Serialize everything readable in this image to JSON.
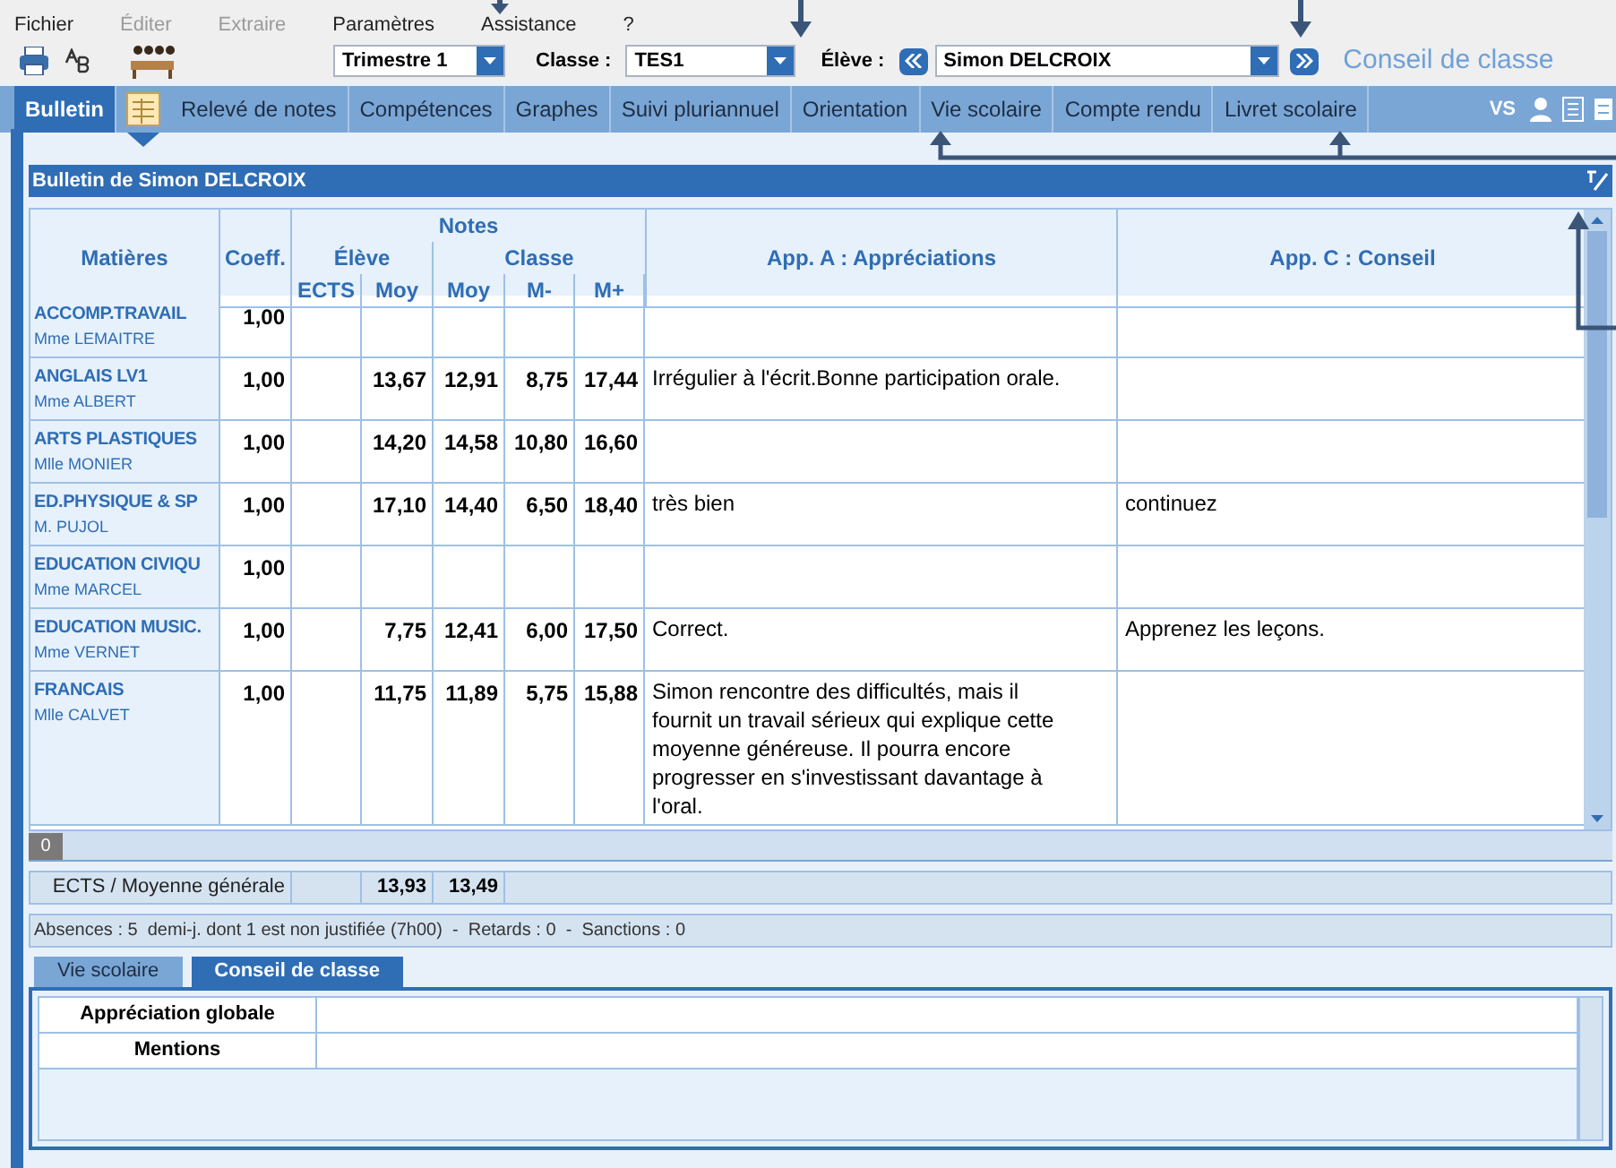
{
  "menu": [
    {
      "label": "Fichier",
      "disabled": false
    },
    {
      "label": "Éditer",
      "disabled": true
    },
    {
      "label": "Extraire",
      "disabled": true
    },
    {
      "label": "Paramètres",
      "disabled": false
    },
    {
      "label": "Assistance",
      "disabled": false
    },
    {
      "label": "?",
      "disabled": false
    }
  ],
  "toolbar": {
    "period": {
      "value": "Trimestre 1"
    },
    "class_label": "Classe :",
    "class": {
      "value": "TES1"
    },
    "student_label": "Élève :",
    "student": {
      "value": "Simon DELCROIX"
    },
    "view_title": "Conseil de classe"
  },
  "tabs": [
    {
      "label": "Bulletin",
      "selected": true
    },
    {
      "label": "Relevé de notes",
      "selected": false
    },
    {
      "label": "Compétences",
      "selected": false
    },
    {
      "label": "Graphes",
      "selected": false
    },
    {
      "label": "Suivi pluriannuel",
      "selected": false
    },
    {
      "label": "Orientation",
      "selected": false
    },
    {
      "label": "Vie scolaire",
      "selected": false
    },
    {
      "label": "Compte rendu",
      "selected": false
    },
    {
      "label": "Livret scolaire",
      "selected": false
    }
  ],
  "tab_bar_text": "VS",
  "panel_title": "Bulletin de Simon DELCROIX",
  "table": {
    "headers": {
      "subject": "Matières",
      "coeff": "Coeff.",
      "notes": "Notes",
      "student": "Élève",
      "class": "Classe",
      "ects": "ECTS",
      "moy": "Moy",
      "class_moy": "Moy",
      "class_min": "M-",
      "class_max": "M+",
      "app_a": "App. A : Appréciations",
      "app_c": "App. C : Conseil"
    },
    "rows": [
      {
        "subject": "ACCOMP.TRAVAIL",
        "teacher": "Mme LEMAITRE",
        "coeff": "1,00",
        "moy": "",
        "class_moy": "",
        "class_min": "",
        "class_max": "",
        "app_a": "",
        "app_c": ""
      },
      {
        "subject": "ANGLAIS LV1",
        "teacher": "Mme ALBERT",
        "coeff": "1,00",
        "moy": "13,67",
        "class_moy": "12,91",
        "class_min": "8,75",
        "class_max": "17,44",
        "app_a": "Irrégulier à l'écrit.Bonne participation orale.",
        "app_c": ""
      },
      {
        "subject": "ARTS PLASTIQUES",
        "teacher": "Mlle MONIER",
        "coeff": "1,00",
        "moy": "14,20",
        "class_moy": "14,58",
        "class_min": "10,80",
        "class_max": "16,60",
        "app_a": "",
        "app_c": ""
      },
      {
        "subject": "ED.PHYSIQUE & SP",
        "teacher": "M. PUJOL",
        "coeff": "1,00",
        "moy": "17,10",
        "class_moy": "14,40",
        "class_min": "6,50",
        "class_max": "18,40",
        "app_a": "très bien",
        "app_c": "continuez"
      },
      {
        "subject": "EDUCATION CIVIQU",
        "teacher": "Mme MARCEL",
        "coeff": "1,00",
        "moy": "",
        "class_moy": "",
        "class_min": "",
        "class_max": "",
        "app_a": "",
        "app_c": ""
      },
      {
        "subject": "EDUCATION MUSIC.",
        "teacher": "Mme VERNET",
        "coeff": "1,00",
        "moy": "7,75",
        "class_moy": "12,41",
        "class_min": "6,00",
        "class_max": "17,50",
        "app_a": "Correct.",
        "app_c": "Apprenez les leçons."
      },
      {
        "subject": "FRANCAIS",
        "teacher": "Mlle CALVET",
        "coeff": "1,00",
        "moy": "11,75",
        "class_moy": "11,89",
        "class_min": "5,75",
        "class_max": "15,88",
        "app_a": "Simon rencontre des difficultés, mais il fournit un travail sérieux qui explique cette moyenne généreuse. Il pourra encore progresser en s'investissant davantage à l'oral.",
        "app_c": ""
      }
    ]
  },
  "scroll_badge": "0",
  "summary": {
    "label": "ECTS / Moyenne générale",
    "student_avg": "13,93",
    "class_avg": "13,49"
  },
  "absences": "Absences : 5  demi-j. dont 1 est non justifiée (7h00)  -  Retards : 0  -  Sanctions : 0",
  "bottom_tabs": [
    {
      "label": "Vie scolaire",
      "selected": false
    },
    {
      "label": "Conseil de classe",
      "selected": true
    }
  ],
  "conseil_rows": [
    {
      "label": "Appréciation globale",
      "value": ""
    },
    {
      "label": "Mentions",
      "value": ""
    }
  ]
}
